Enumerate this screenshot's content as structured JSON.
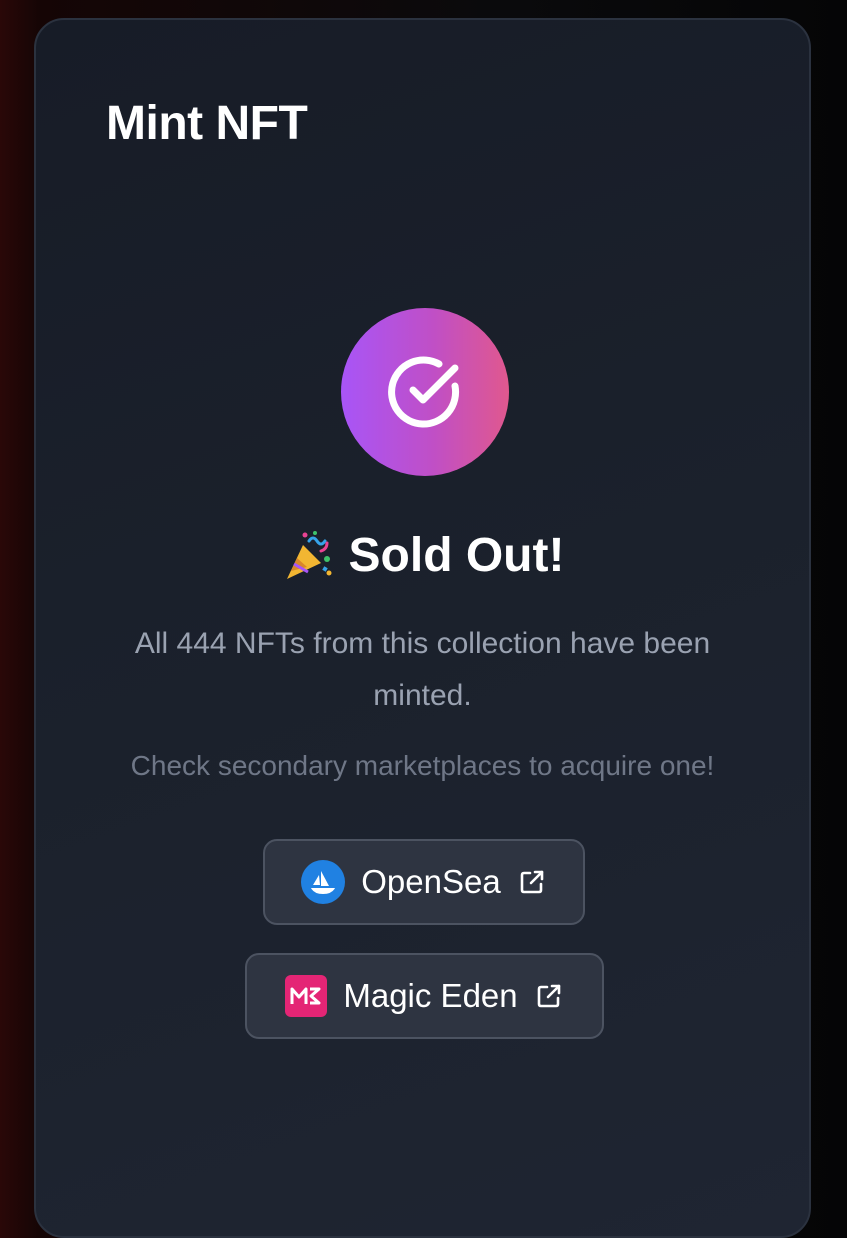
{
  "card": {
    "title": "Mint NFT"
  },
  "status": {
    "heading": "Sold Out!",
    "heading_icon": "party-popper-icon",
    "badge_icon": "check-circle-icon",
    "description": "All 444 NFTs from this collection have been minted.",
    "hint": "Check secondary marketplaces to acquire one!"
  },
  "marketplaces": [
    {
      "label": "OpenSea",
      "icon": "opensea-logo-icon",
      "link_icon": "external-link-icon"
    },
    {
      "label": "Magic Eden",
      "icon": "magic-eden-logo-icon",
      "link_icon": "external-link-icon"
    }
  ],
  "colors": {
    "badge_gradient_start": "#a855f7",
    "badge_gradient_end": "#e0588e",
    "opensea_blue": "#2081e2",
    "magic_eden_pink": "#e42575"
  }
}
